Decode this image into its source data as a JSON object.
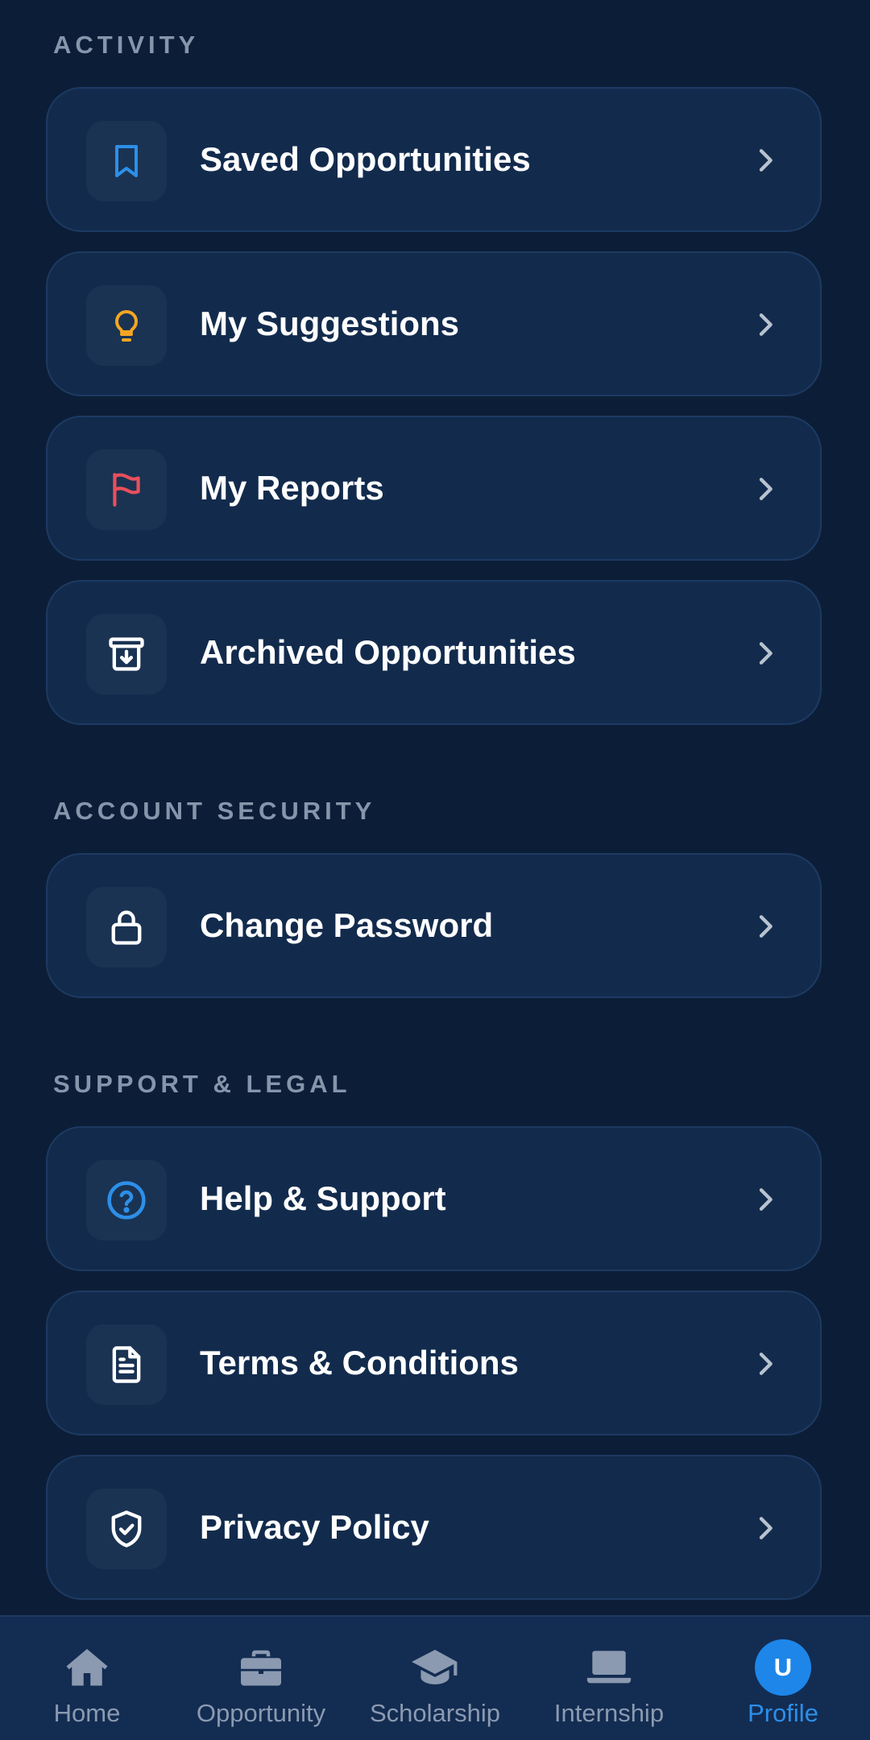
{
  "sections": {
    "activity": {
      "label": "ACTIVITY",
      "items": [
        {
          "label": "Saved Opportunities",
          "icon": "bookmark-icon"
        },
        {
          "label": "My Suggestions",
          "icon": "lightbulb-icon"
        },
        {
          "label": "My Reports",
          "icon": "flag-icon"
        },
        {
          "label": "Archived Opportunities",
          "icon": "archive-icon"
        }
      ]
    },
    "account_security": {
      "label": "ACCOUNT SECURITY",
      "items": [
        {
          "label": "Change Password",
          "icon": "lock-icon"
        }
      ]
    },
    "support_legal": {
      "label": "SUPPORT & LEGAL",
      "items": [
        {
          "label": "Help & Support",
          "icon": "help-circle-icon"
        },
        {
          "label": "Terms & Conditions",
          "icon": "document-icon"
        },
        {
          "label": "Privacy Policy",
          "icon": "shield-check-icon"
        }
      ]
    }
  },
  "bottom_nav": {
    "items": [
      {
        "label": "Home",
        "icon": "home-icon"
      },
      {
        "label": "Opportunity",
        "icon": "briefcase-icon"
      },
      {
        "label": "Scholarship",
        "icon": "graduation-cap-icon"
      },
      {
        "label": "Internship",
        "icon": "laptop-icon"
      },
      {
        "label": "Profile",
        "icon": "avatar",
        "avatar_letter": "U",
        "active": true
      }
    ]
  },
  "colors": {
    "background": "#0c1e37",
    "card": "#122b4d",
    "accent_blue": "#2d8fe8",
    "bulb_orange": "#f5a623",
    "flag_red": "#e8505b",
    "muted_label": "#8596ac"
  }
}
